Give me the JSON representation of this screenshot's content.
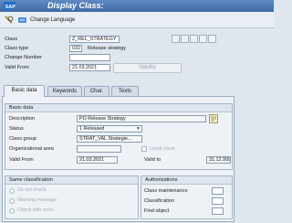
{
  "window": {
    "title": "Display Class:"
  },
  "toolbar": {
    "change_language": "Change Language"
  },
  "header": {
    "class_label": "Class",
    "class_value": "Z_REL_STRATEGY",
    "class_type_label": "Class type",
    "class_type_value": "032",
    "class_type_desc": "Release strategy",
    "change_number_label": "Change Number",
    "change_number_value": "",
    "valid_from_label": "Valid From",
    "valid_from_value": "21.03.2021",
    "validity_button": "Validity"
  },
  "tabs": [
    {
      "label": "Basic data"
    },
    {
      "label": "Keywords"
    },
    {
      "label": "Char."
    },
    {
      "label": "Texts"
    }
  ],
  "basic_data": {
    "title": "Basic data",
    "description_label": "Description",
    "description_value": "PO Release Strategy",
    "status_label": "Status",
    "status_value": "1 Released",
    "class_group_label": "Class group",
    "class_group_value": "STRAT_VAL Strategie...",
    "org_area_label": "Organizational area",
    "local_class_label": "Local class",
    "valid_from_label": "Valid From",
    "valid_from_value": "21.03.2021",
    "valid_to_label": "Valid to",
    "valid_to_value": "31.12.9999"
  },
  "same_classification": {
    "title": "Same classification",
    "options": [
      "Do not check",
      "Warning message",
      "Check with error"
    ]
  },
  "authorizations": {
    "title": "Authorizations",
    "rows": [
      "Class maintenance",
      "Classification",
      "Find object"
    ]
  }
}
